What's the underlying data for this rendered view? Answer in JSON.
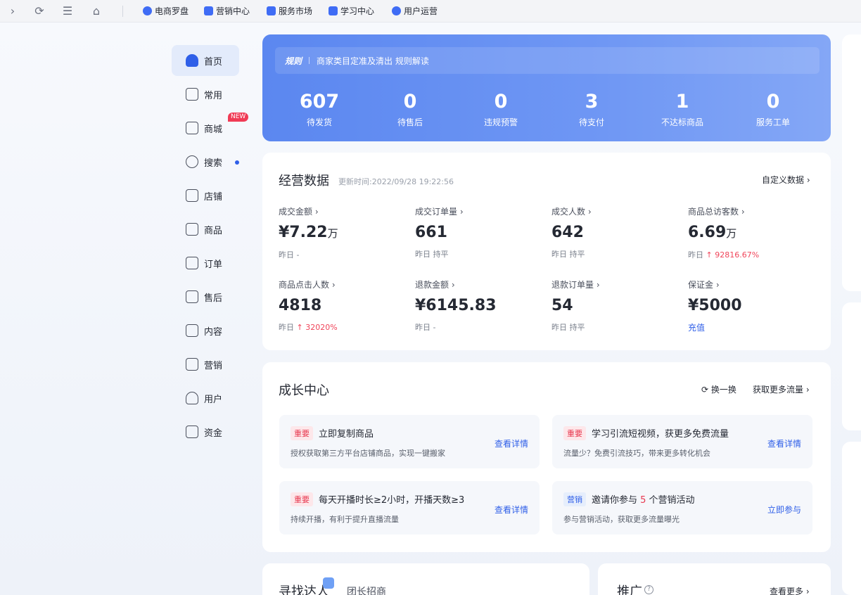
{
  "topnav": {
    "links": [
      "电商罗盘",
      "营销中心",
      "服务市场",
      "学习中心",
      "用户运营"
    ]
  },
  "sidebar": {
    "items": [
      {
        "label": "首页"
      },
      {
        "label": "常用"
      },
      {
        "label": "商城",
        "badge": "NEW"
      },
      {
        "label": "搜索"
      },
      {
        "label": "店铺"
      },
      {
        "label": "商品"
      },
      {
        "label": "订单"
      },
      {
        "label": "售后"
      },
      {
        "label": "内容"
      },
      {
        "label": "营销"
      },
      {
        "label": "用户"
      },
      {
        "label": "资金"
      }
    ]
  },
  "banner": {
    "notice_tag": "规则",
    "notice_text": "商家类目定准及清出 规则解读",
    "stats": [
      {
        "value": "607",
        "label": "待发货"
      },
      {
        "value": "0",
        "label": "待售后"
      },
      {
        "value": "0",
        "label": "违规预警"
      },
      {
        "value": "3",
        "label": "待支付"
      },
      {
        "value": "1",
        "label": "不达标商品"
      },
      {
        "value": "0",
        "label": "服务工单"
      }
    ]
  },
  "business": {
    "title": "经营数据",
    "updated": "更新时间:2022/09/28 19:22:56",
    "custom_link": "自定义数据 ›",
    "metrics": [
      {
        "title": "成交金额 ›",
        "value": "¥7.22",
        "unit": "万",
        "sub": "昨日 -",
        "up": ""
      },
      {
        "title": "成交订单量 ›",
        "value": "661",
        "unit": "",
        "sub": "昨日 持平",
        "up": ""
      },
      {
        "title": "成交人数 ›",
        "value": "642",
        "unit": "",
        "sub": "昨日 持平",
        "up": ""
      },
      {
        "title": "商品总访客数 ›",
        "value": "6.69",
        "unit": "万",
        "sub": "昨日",
        "up": "↑ 92816.67%"
      },
      {
        "title": "商品点击人数 ›",
        "value": "4818",
        "unit": "",
        "sub": "昨日",
        "up": "↑ 32020%"
      },
      {
        "title": "退款金额 ›",
        "value": "¥6145.83",
        "unit": "",
        "sub": "昨日 -",
        "up": ""
      },
      {
        "title": "退款订单量 ›",
        "value": "54",
        "unit": "",
        "sub": "昨日 持平",
        "up": ""
      },
      {
        "title": "保证金 ›",
        "value": "¥5000",
        "unit": "",
        "sub": "",
        "up": "",
        "link": "充值"
      }
    ]
  },
  "growth": {
    "title": "成长中心",
    "refresh": "换一换",
    "more": "获取更多流量 ›",
    "tasks": [
      {
        "badge": "重要",
        "title": "立即复制商品",
        "desc": "授权获取第三方平台店铺商品，实现一键搬家",
        "action": "查看详情"
      },
      {
        "badge": "重要",
        "title": "学习引流短视频，获更多免费流量",
        "desc": "流量少？免费引流技巧，带来更多转化机会",
        "action": "查看详情"
      },
      {
        "badge": "重要",
        "title": "每天开播时长≥2小时，开播天数≥3",
        "desc": "持续开播，有利于提升直播流量",
        "action": "查看详情"
      },
      {
        "badge": "营销",
        "title_pre": "邀请你参与 ",
        "title_num": "5",
        "title_post": " 个营销活动",
        "desc": "参与营销活动，获取更多流量曝光",
        "action": "立即参与"
      }
    ]
  },
  "bottom": {
    "talent_title": "寻找达人",
    "talent_tab": "团长招商",
    "promo_title": "推广",
    "promo_more": "查看更多 ›"
  }
}
